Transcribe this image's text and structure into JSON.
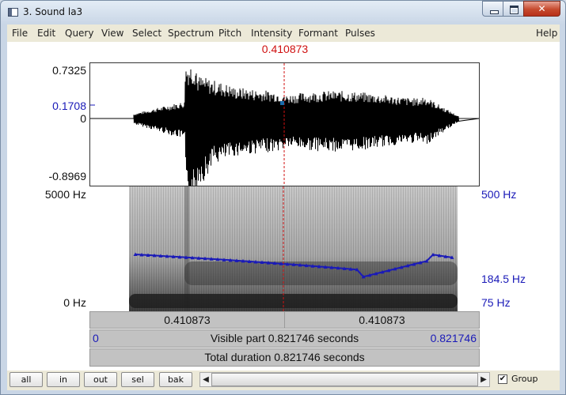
{
  "window": {
    "title": "3. Sound la3",
    "minimize_icon": "minimize-icon",
    "maximize_icon": "maximize-icon",
    "close_glyph": "✕"
  },
  "menu": {
    "items": [
      "File",
      "Edit",
      "Query",
      "View",
      "Select",
      "Spectrum",
      "Pitch",
      "Intensity",
      "Formant",
      "Pulses"
    ],
    "help": "Help"
  },
  "cursor": {
    "time": "0.410873"
  },
  "waveform": {
    "y_max": "0.7325",
    "y_cursor": "0.1708",
    "y_zero": "0",
    "y_min": "-0.8969"
  },
  "spectrogram": {
    "freq_top": "5000 Hz",
    "freq_bottom": "0 Hz",
    "pitch_top": "500 Hz",
    "pitch_value": "184.5 Hz",
    "pitch_bottom": "75 Hz"
  },
  "panels": {
    "left_time": "0.410873",
    "right_time": "0.410873",
    "visible_start": "0",
    "visible_label": "Visible part 0.821746 seconds",
    "visible_end": "0.821746",
    "total_label": "Total duration 0.821746 seconds"
  },
  "toolbar": {
    "buttons": [
      "all",
      "in",
      "out",
      "sel",
      "bak"
    ],
    "group_label": "Group",
    "group_checked": "✔"
  },
  "colors": {
    "cursor": "#d01010",
    "pitch": "#1a1ab8",
    "panel": "#c2c2c2"
  }
}
